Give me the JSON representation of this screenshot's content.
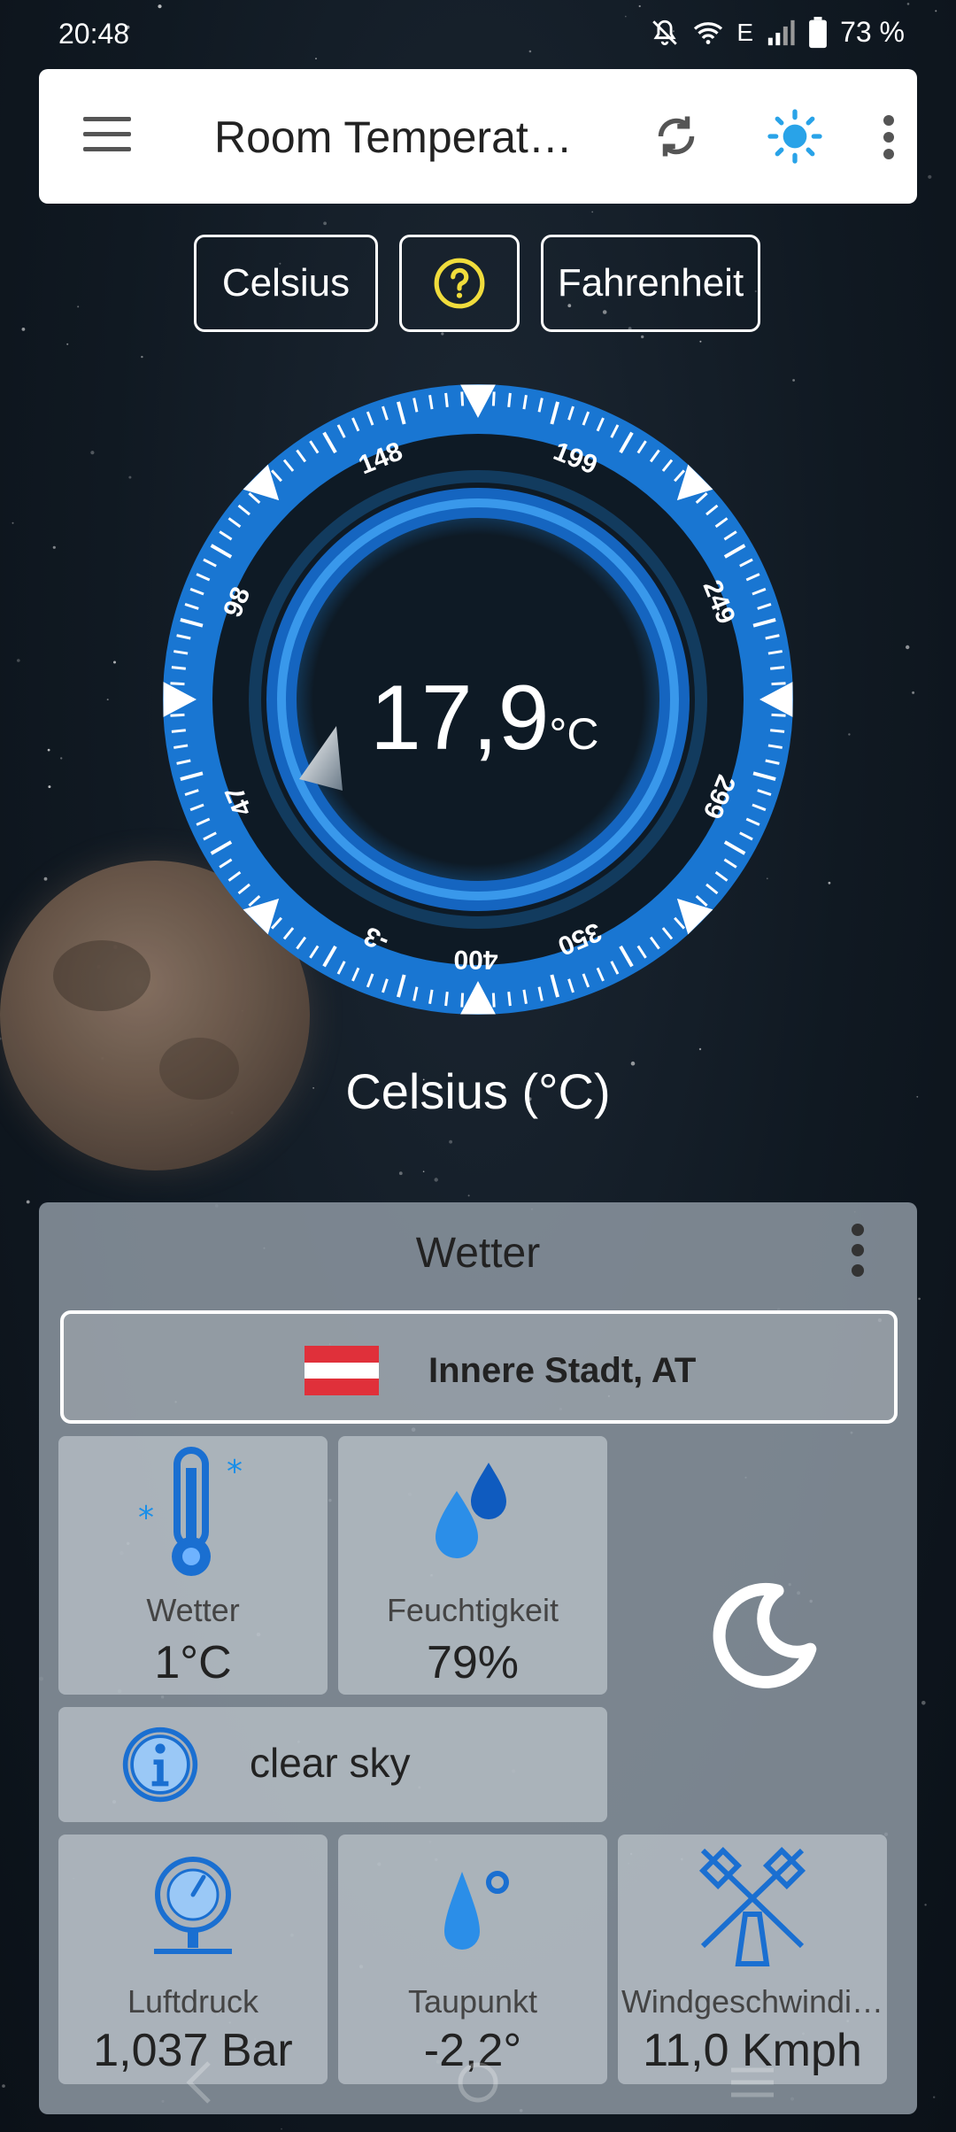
{
  "status_bar": {
    "time": "20:48",
    "network": "E",
    "battery": "73 %",
    "icons": [
      "bell-muted-icon",
      "wifi-icon",
      "signal-icon",
      "battery-icon"
    ]
  },
  "app_bar": {
    "title": "Room Temperat…",
    "icons": [
      "menu-icon",
      "refresh-icon",
      "sun-icon",
      "more-vert-icon"
    ],
    "accent": "#2196f3"
  },
  "unit_buttons": {
    "celsius": "Celsius",
    "help_icon": "help-circle-icon",
    "fahrenheit": "Fahrenheit"
  },
  "gauge": {
    "value": "17,9",
    "unit": "°C",
    "scale_labels": [
      "-3",
      "47",
      "98",
      "148",
      "199",
      "249",
      "299",
      "350",
      "400"
    ],
    "ring_color": "#1e88e5"
  },
  "unit_label": "Celsius  (°C)",
  "weather": {
    "title": "Wetter",
    "location": "Innere Stadt, AT",
    "flag_colors": [
      "#e0303a",
      "#ffffff",
      "#e0303a"
    ],
    "tiles": {
      "weather": {
        "label": "Wetter",
        "value": "1°C",
        "icon": "thermometer-snow-icon"
      },
      "humidity": {
        "label": "Feuchtigkeit",
        "value": "79%",
        "icon": "water-drops-icon"
      },
      "condition": {
        "text": "clear sky",
        "icon": "info-icon"
      },
      "night_icon": "moon-icon",
      "pressure": {
        "label": "Luftdruck",
        "value": "1,037 Bar",
        "icon": "barometer-icon"
      },
      "dew_point": {
        "label": "Taupunkt",
        "value": "-2,2°",
        "icon": "dew-drop-icon"
      },
      "wind": {
        "label": "Windgeschwindi…",
        "value": "11,0 Kmph",
        "icon": "windmill-icon"
      }
    }
  }
}
